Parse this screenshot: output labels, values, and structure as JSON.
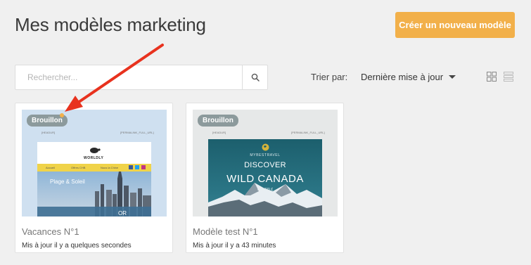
{
  "header": {
    "title": "Mes modèles marketing",
    "create_button": "Créer un nouveau modèle"
  },
  "toolbar": {
    "search_placeholder": "Rechercher...",
    "sort_label": "Trier par:",
    "sort_value": "Dernière mise à jour"
  },
  "templates": [
    {
      "status": "Brouillon",
      "title": "Vacances N°1",
      "updated": "Mis à jour il y a quelques secondes",
      "preview": {
        "header_left": "[HEADUR]",
        "header_right": "[PERMALINK_FULL_URL]",
        "brand": "WORLDLY",
        "nav": [
          "Accueil",
          "Offres CHB",
          "Nous la Chine"
        ],
        "hero_text": "Plage & Soleil",
        "hero_partial": "OR"
      }
    },
    {
      "status": "Brouillon",
      "title": "Modèle test N°1",
      "updated": "Mis à jour il y a 43 minutes",
      "preview": {
        "header_left": "[HEADUR]",
        "header_right": "[PERMALINK_FULL_URL]",
        "brand": "MYBESTRAVEL",
        "headline": "DISCOVER",
        "headline2": "WILD CANADA",
        "price": "dès 899 €"
      }
    }
  ],
  "colors": {
    "accent": "#f2b04a",
    "badge": "#8c9a9c",
    "arrow": "#e8321e",
    "hero_teal": "#1a5f6b"
  }
}
